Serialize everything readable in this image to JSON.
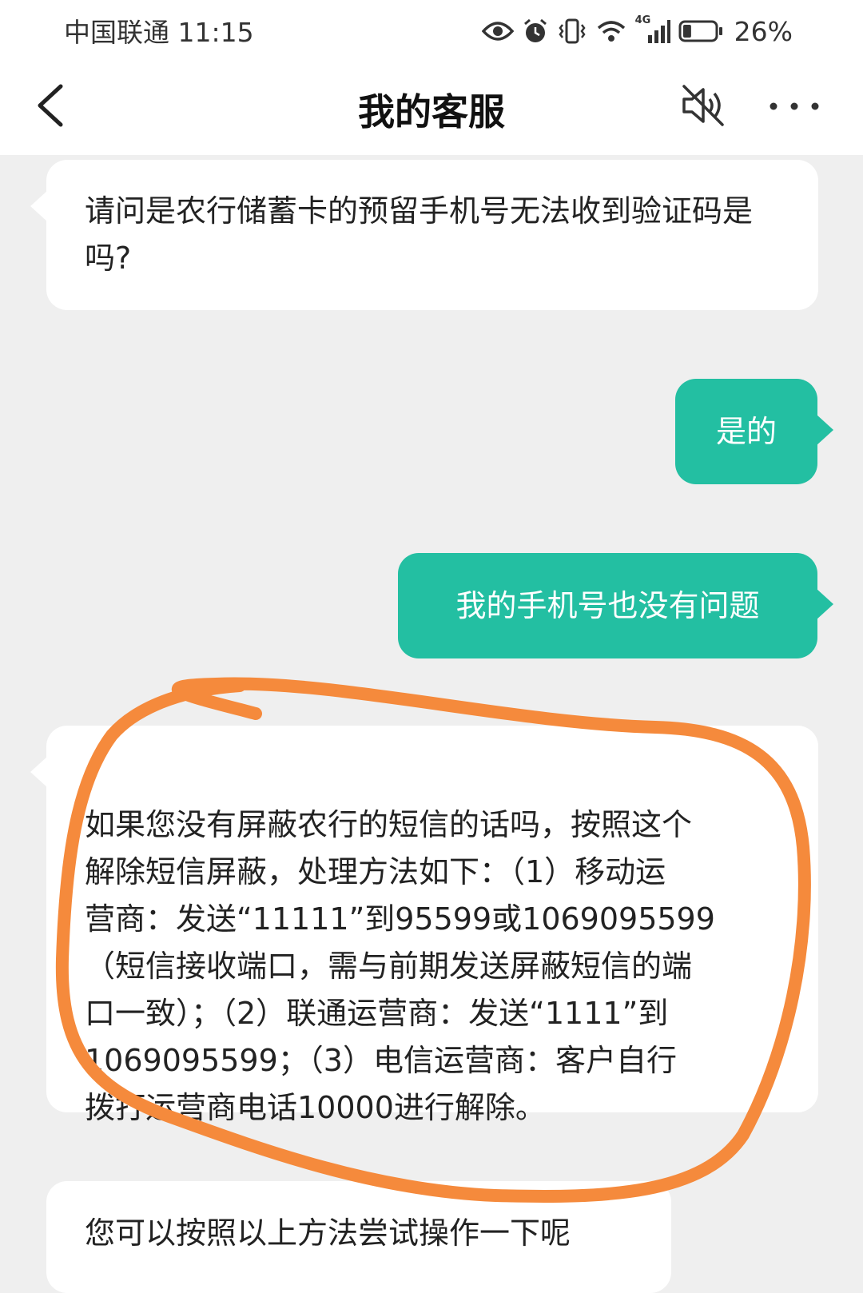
{
  "status_bar": {
    "carrier_time": "中国联通 11:15",
    "network_label": "4G",
    "battery_percent": "26%",
    "battery_level": 0.26,
    "icons": [
      "eye-icon",
      "alarm-icon",
      "vibrate-icon",
      "wifi-icon",
      "signal-icon",
      "battery-icon"
    ]
  },
  "nav": {
    "title": "我的客服",
    "back_icon": "chevron-left-icon",
    "mute_icon": "speaker-muted-icon",
    "more_icon": "more-dots-icon"
  },
  "messages": [
    {
      "side": "left",
      "text": "请问是农行储蓄卡的预留手机号无法收到验证码是吗?"
    },
    {
      "side": "right",
      "text": "是的"
    },
    {
      "side": "right",
      "text": "我的手机号也没有问题"
    },
    {
      "side": "left",
      "text": "如果您没有屏蔽农行的短信的话吗，按照这个\n解除短信屏蔽，处理方法如下：（1）移动运\n营商：发送“11111”到95599或1069095599\n（短信接收端口，需与前期发送屏蔽短信的端\n口一致）；（2）联通运营商：发送“1111”到\n1069095599；（3）电信运营商：客户自行\n拨打运营商电话10000进行解除。"
    },
    {
      "side": "left",
      "text": "您可以按照以上方法尝试操作一下呢"
    }
  ],
  "colors": {
    "accent": "#23bfa2",
    "annotation": "#f58a3c",
    "background": "#efefef"
  }
}
